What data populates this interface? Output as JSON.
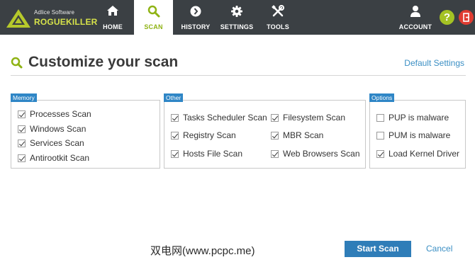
{
  "app": {
    "brand_small": "Adlice Software",
    "brand_big": "ROGUEKILLER"
  },
  "nav": {
    "items": [
      {
        "label": "HOME",
        "icon": "home-icon"
      },
      {
        "label": "SCAN",
        "icon": "search-icon",
        "active": true
      },
      {
        "label": "HISTORY",
        "icon": "history-icon"
      },
      {
        "label": "SETTINGS",
        "icon": "gear-icon"
      },
      {
        "label": "TOOLS",
        "icon": "tools-icon"
      }
    ],
    "account_label": "ACCOUNT",
    "help_glyph": "?",
    "colors": {
      "bar": "#3b4044",
      "active": "#8fb314",
      "help": "#a4c224",
      "exit": "#e03c31"
    }
  },
  "header": {
    "title": "Customize your scan",
    "default_settings": "Default Settings"
  },
  "groups": {
    "memory": {
      "label": "Memory",
      "options": [
        {
          "label": "Processes Scan",
          "checked": true
        },
        {
          "label": "Windows Scan",
          "checked": true
        },
        {
          "label": "Services Scan",
          "checked": true
        },
        {
          "label": "Antirootkit Scan",
          "checked": true
        }
      ]
    },
    "other": {
      "label": "Other",
      "options": [
        {
          "label": "Tasks Scheduler Scan",
          "checked": true
        },
        {
          "label": "Registry Scan",
          "checked": true
        },
        {
          "label": "Hosts File Scan",
          "checked": true
        },
        {
          "label": "Filesystem Scan",
          "checked": true
        },
        {
          "label": "MBR Scan",
          "checked": true
        },
        {
          "label": "Web Browsers Scan",
          "checked": true
        }
      ]
    },
    "options": {
      "label": "Options",
      "options": [
        {
          "label": "PUP is malware",
          "checked": false
        },
        {
          "label": "PUM is malware",
          "checked": false
        },
        {
          "label": "Load Kernel Driver",
          "checked": true
        }
      ]
    }
  },
  "footer": {
    "watermark": "双电网(www.pcpc.me)",
    "start_scan": "Start Scan",
    "cancel": "Cancel"
  }
}
